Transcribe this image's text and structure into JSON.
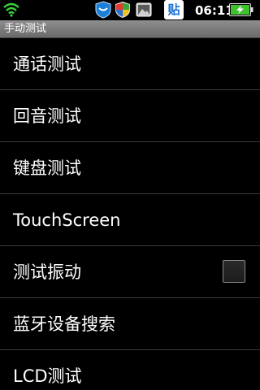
{
  "status_bar": {
    "time": "06:11",
    "tieba_label": "贴",
    "icons": [
      "wifi-icon",
      "shield-icon",
      "security-icon",
      "gallery-icon",
      "tieba-icon",
      "battery-charging-icon"
    ]
  },
  "title_bar": {
    "title": "手动测试"
  },
  "menu": {
    "items": [
      {
        "label": "通话测试"
      },
      {
        "label": "回音测试"
      },
      {
        "label": "键盘测试"
      },
      {
        "label": "TouchScreen"
      },
      {
        "label": "测试振动",
        "checked": false
      },
      {
        "label": "蓝牙设备搜索"
      },
      {
        "label": "LCD测试"
      }
    ]
  },
  "colors": {
    "background": "#000000",
    "title_bar": "#7a7a7a",
    "divider": "#3a3a3a",
    "text": "#ffffff",
    "battery_green": "#3fc02f",
    "shield_blue": "#1a7fd6"
  }
}
